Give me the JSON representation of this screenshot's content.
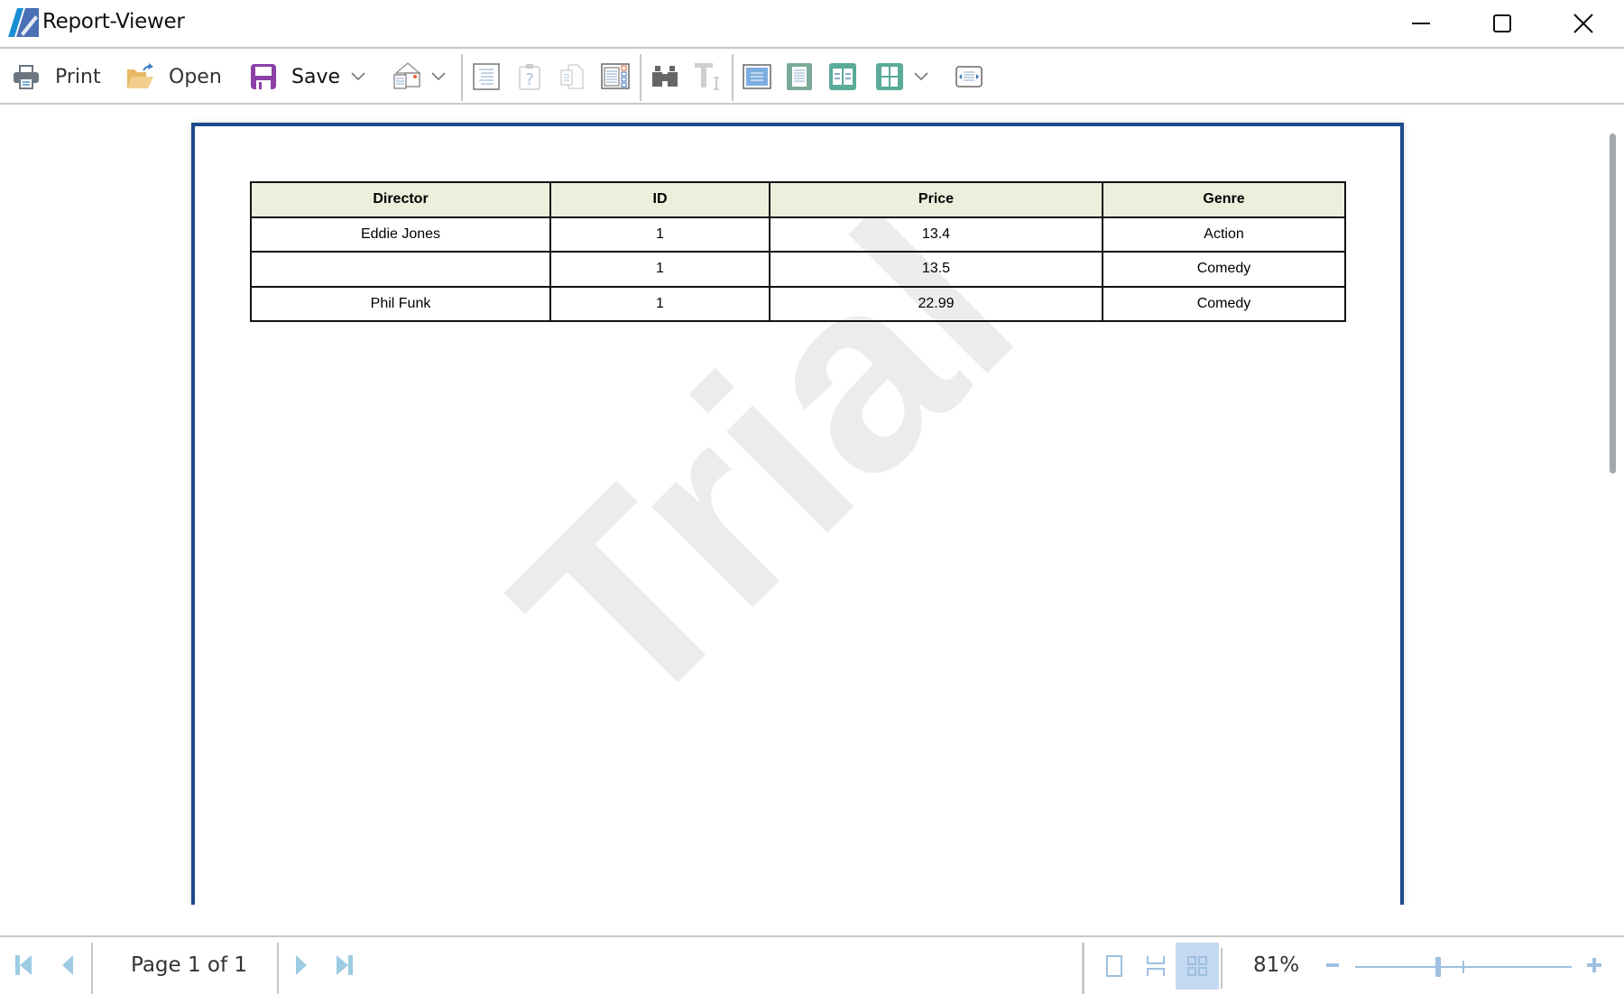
{
  "window": {
    "title": "Report-Viewer",
    "controls": {
      "minimize": "minimize-icon",
      "maximize": "maximize-icon",
      "close": "close-icon"
    }
  },
  "toolbar": {
    "print_label": "Print",
    "open_label": "Open",
    "save_label": "Save",
    "icons": [
      "printer-icon",
      "open-folder-icon",
      "save-disk-icon",
      "chevron-down-icon",
      "email-icon",
      "chevron-down-icon",
      "document-map-icon",
      "parameters-icon",
      "copy-pages-icon",
      "thumbnails-icon",
      "find-icon",
      "text-select-icon",
      "single-page-icon",
      "continuous-page-icon",
      "two-page-icon",
      "multi-page-icon",
      "chevron-down-icon",
      "page-width-icon"
    ]
  },
  "report": {
    "columns": [
      "Director",
      "ID",
      "Price",
      "Genre"
    ],
    "rows": [
      [
        "Eddie Jones",
        "1",
        "13.4",
        "Action"
      ],
      [
        "",
        "1",
        "13.5",
        "Comedy"
      ],
      [
        "Phil Funk",
        "1",
        "22.99",
        "Comedy"
      ]
    ],
    "watermark": "Trial"
  },
  "statusbar": {
    "page_indicator": "Page 1 of 1",
    "zoom_value": "81%",
    "zoom_percent": 81,
    "view_modes": [
      "single-page-view",
      "continuous-view",
      "multi-page-view"
    ],
    "selected_view_mode": "multi-page-view",
    "zoom_minus": "−",
    "zoom_plus": "+"
  },
  "colors": {
    "page_border": "#1c4a8c",
    "table_header_bg": "#ebf0dc",
    "nav_icon": "#9dcbe3",
    "save_icon": "#8b3fa7",
    "selected_view_bg": "#c5d8f1"
  }
}
